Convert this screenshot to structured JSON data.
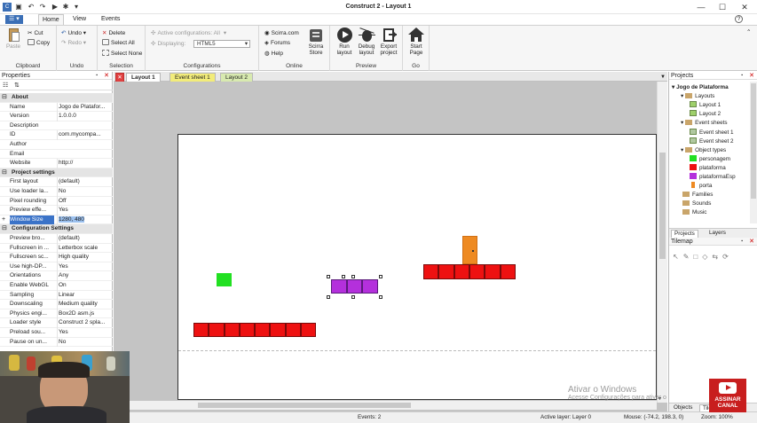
{
  "window": {
    "title": "Construct 2 - Layout 1",
    "controls": {
      "minimize": "—",
      "maximize": "☐",
      "close": "✕"
    }
  },
  "menu": {
    "app_button": "☰ ▾",
    "tabs": [
      "Home",
      "View",
      "Events"
    ],
    "active_tab": "Home",
    "help_icon": "?"
  },
  "ribbon": {
    "clipboard": {
      "paste": "Paste",
      "cut": "Cut",
      "copy": "Copy",
      "label": "Clipboard"
    },
    "undo": {
      "undo": "Undo ▾",
      "redo": "Redo ▾",
      "label": "Undo"
    },
    "selection": {
      "delete": "Delete",
      "select_all": "Select All",
      "select_none": "Select None",
      "label": "Selection"
    },
    "configurations": {
      "active": "Active configurations: All",
      "displaying_label": "Displaying:",
      "displaying_value": "HTML5",
      "label": "Configurations"
    },
    "online": {
      "scirra_com": "Scirra.com",
      "forums": "Forums",
      "help": "Help",
      "store_line1": "Scirra",
      "store_line2": "Store",
      "label": "Online"
    },
    "preview": {
      "run_line1": "Run",
      "run_line2": "layout",
      "debug_line1": "Debug",
      "debug_line2": "layout",
      "export_line1": "Export",
      "export_line2": "project",
      "label": "Preview"
    },
    "go": {
      "start_line1": "Start",
      "start_line2": "Page",
      "label": "Go"
    }
  },
  "properties": {
    "title": "Properties",
    "pin": "📌",
    "close": "✕",
    "rows": [
      {
        "type": "section",
        "name": "About"
      },
      {
        "name": "Name",
        "value": "Jogo de Platafor..."
      },
      {
        "name": "Version",
        "value": "1.0.0.0"
      },
      {
        "name": "Description",
        "value": ""
      },
      {
        "name": "ID",
        "value": "com.mycompa..."
      },
      {
        "name": "Author",
        "value": ""
      },
      {
        "name": "Email",
        "value": ""
      },
      {
        "name": "Website",
        "value": "http://"
      },
      {
        "type": "section",
        "name": "Project settings"
      },
      {
        "name": "First layout",
        "value": "(default)"
      },
      {
        "name": "Use loader la...",
        "value": "No"
      },
      {
        "name": "Pixel rounding",
        "value": "Off"
      },
      {
        "name": "Preview effe...",
        "value": "Yes"
      },
      {
        "name": "Window Size",
        "value": "1280, 480",
        "selected": true,
        "expand": "+"
      },
      {
        "type": "section",
        "name": "Configuration Settings"
      },
      {
        "name": "Preview bro...",
        "value": "(default)"
      },
      {
        "name": "Fullscreen in ...",
        "value": "Letterbox scale"
      },
      {
        "name": "Fullscreen sc...",
        "value": "High quality"
      },
      {
        "name": "Use high-DP...",
        "value": "Yes"
      },
      {
        "name": "Orientations",
        "value": "Any"
      },
      {
        "name": "Enable WebGL",
        "value": "On"
      },
      {
        "name": "Sampling",
        "value": "Linear"
      },
      {
        "name": "Downscaling",
        "value": "Medium quality"
      },
      {
        "name": "Physics engi...",
        "value": "Box2D asm.js"
      },
      {
        "name": "Loader style",
        "value": "Construct 2 spla..."
      },
      {
        "name": "Preload sou...",
        "value": "Yes"
      },
      {
        "name": "Pause on un...",
        "value": "No"
      }
    ]
  },
  "doc_tabs": [
    "Layout 1",
    "Event sheet 1",
    "Layout 2"
  ],
  "doc_tabs_close": "✕",
  "doc_tabs_dropdown": "▼",
  "colors": {
    "green": "#22e022",
    "red": "#ee1111",
    "purple": "#b430dc",
    "orange": "#ee8a22"
  },
  "projects": {
    "title": "Projects",
    "tree": [
      {
        "label": "Jogo de Plataforma",
        "level": 0,
        "kind": "root",
        "bold": true
      },
      {
        "label": "Layouts",
        "level": 1,
        "kind": "folder"
      },
      {
        "label": "Layout 1",
        "level": 2,
        "kind": "layout"
      },
      {
        "label": "Layout 2",
        "level": 2,
        "kind": "layout"
      },
      {
        "label": "Event sheets",
        "level": 1,
        "kind": "folder"
      },
      {
        "label": "Event sheet 1",
        "level": 2,
        "kind": "sheet"
      },
      {
        "label": "Event sheet 2",
        "level": 2,
        "kind": "sheet"
      },
      {
        "label": "Object types",
        "level": 1,
        "kind": "folder"
      },
      {
        "label": "personagem",
        "level": 2,
        "kind": "object",
        "color": "#22e022"
      },
      {
        "label": "plataforma",
        "level": 2,
        "kind": "object",
        "color": "#ee1111"
      },
      {
        "label": "plataformaEsp",
        "level": 2,
        "kind": "object",
        "color": "#b430dc"
      },
      {
        "label": "porta",
        "level": 2,
        "kind": "object",
        "color": "#ee8a22"
      },
      {
        "label": "Families",
        "level": 1,
        "kind": "folder"
      },
      {
        "label": "Sounds",
        "level": 1,
        "kind": "folder"
      },
      {
        "label": "Music",
        "level": 1,
        "kind": "folder"
      }
    ],
    "tabs": [
      "Projects",
      "Layers"
    ]
  },
  "tilemap": {
    "title": "Tilemap",
    "tools": [
      "pointer-icon",
      "pencil-icon",
      "rectangle-icon",
      "eraser-icon",
      "flip-icon",
      "rotate-icon"
    ]
  },
  "bottom_tabs": [
    "Objects",
    "Tilem..."
  ],
  "status": {
    "events": "Events: 2",
    "active_layer": "Active layer: Layer 0",
    "mouse": "Mouse: (-74.2, 198.3, 0)",
    "zoom": "Zoom: 100%"
  },
  "watermark": {
    "line1": "Ativar o Windows",
    "line2": "Acesse Configurações para ativar o"
  },
  "youtube_badge": {
    "line1": "ASSINAR",
    "line2": "CANAL"
  }
}
